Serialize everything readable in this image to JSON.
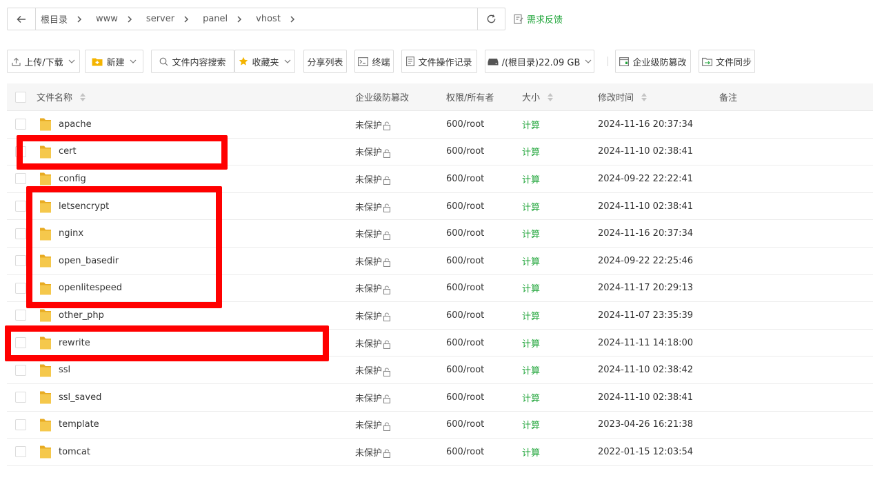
{
  "breadcrumb": {
    "items": [
      "根目录",
      "www",
      "server",
      "panel",
      "vhost"
    ]
  },
  "feedback_label": "需求反馈",
  "toolbar": {
    "upload_label": "上传/下载",
    "new_label": "新建",
    "search_label": "文件内容搜索",
    "favorites_label": "收藏夹",
    "share_label": "分享列表",
    "terminal_label": "终端",
    "log_label": "文件操作记录",
    "disk_label": "/(根目录)22.09 GB",
    "tamper_label": "企业级防篡改",
    "sync_label": "文件同步"
  },
  "table": {
    "headers": {
      "name": "文件名称",
      "protect": "企业级防篡改",
      "perm": "权限/所有者",
      "size": "大小",
      "time": "修改时间",
      "note": "备注"
    },
    "rows": [
      {
        "name": "apache",
        "protect": "未保护",
        "perm": "600/root",
        "size": "计算",
        "time": "2024-11-16 20:37:34"
      },
      {
        "name": "cert",
        "protect": "未保护",
        "perm": "600/root",
        "size": "计算",
        "time": "2024-11-10 02:38:41"
      },
      {
        "name": "config",
        "protect": "未保护",
        "perm": "600/root",
        "size": "计算",
        "time": "2024-09-22 22:22:41"
      },
      {
        "name": "letsencrypt",
        "protect": "未保护",
        "perm": "600/root",
        "size": "计算",
        "time": "2024-11-10 02:38:41"
      },
      {
        "name": "nginx",
        "protect": "未保护",
        "perm": "600/root",
        "size": "计算",
        "time": "2024-11-16 20:37:34"
      },
      {
        "name": "open_basedir",
        "protect": "未保护",
        "perm": "600/root",
        "size": "计算",
        "time": "2024-09-22 22:25:46"
      },
      {
        "name": "openlitespeed",
        "protect": "未保护",
        "perm": "600/root",
        "size": "计算",
        "time": "2024-11-17 20:29:13"
      },
      {
        "name": "other_php",
        "protect": "未保护",
        "perm": "600/root",
        "size": "计算",
        "time": "2024-11-07 23:35:39"
      },
      {
        "name": "rewrite",
        "protect": "未保护",
        "perm": "600/root",
        "size": "计算",
        "time": "2024-11-11 14:18:00"
      },
      {
        "name": "ssl",
        "protect": "未保护",
        "perm": "600/root",
        "size": "计算",
        "time": "2024-11-10 02:38:42"
      },
      {
        "name": "ssl_saved",
        "protect": "未保护",
        "perm": "600/root",
        "size": "计算",
        "time": "2024-11-10 02:38:41"
      },
      {
        "name": "template",
        "protect": "未保护",
        "perm": "600/root",
        "size": "计算",
        "time": "2023-04-26 16:21:38"
      },
      {
        "name": "tomcat",
        "protect": "未保护",
        "perm": "600/root",
        "size": "计算",
        "time": "2022-01-15 12:03:54"
      }
    ]
  },
  "colors": {
    "accent_green": "#20a53a",
    "folder_yellow": "#f5c84c",
    "annotation_red": "#ff0000"
  }
}
